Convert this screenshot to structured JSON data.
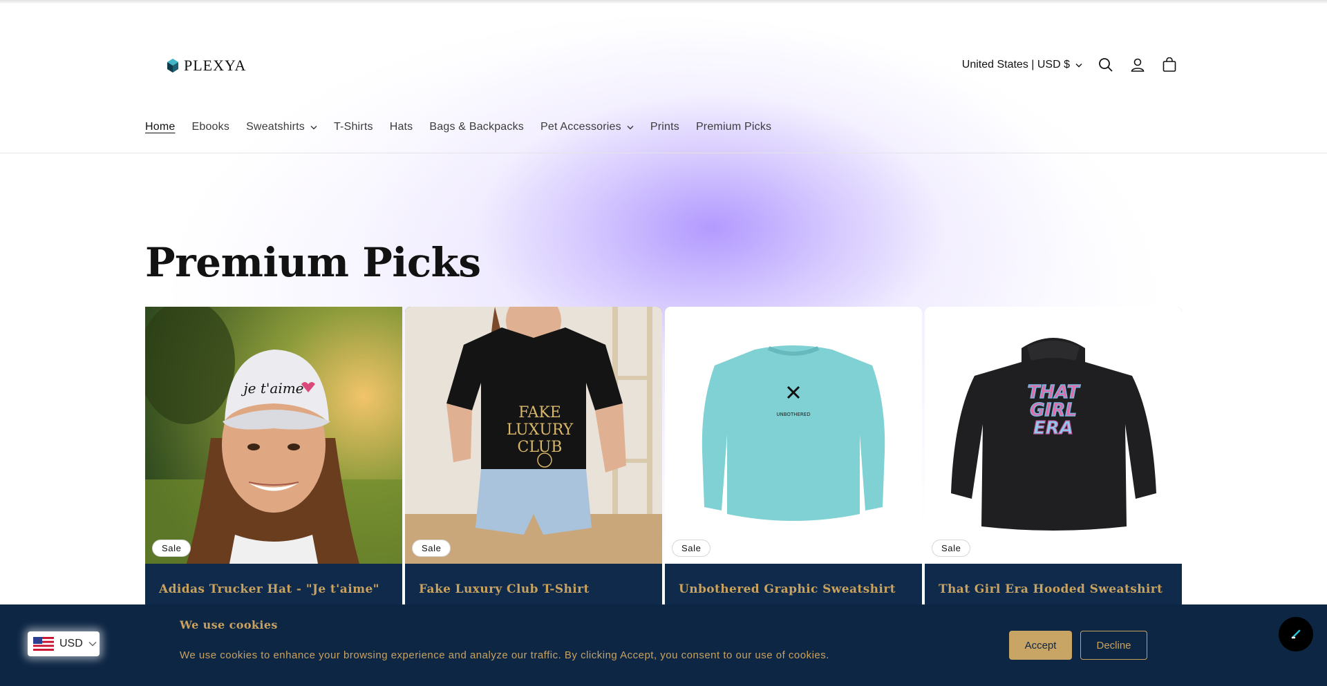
{
  "brand": {
    "name": "PLEXYA"
  },
  "header": {
    "locale": "United States | USD $"
  },
  "nav": {
    "items": [
      {
        "label": "Home",
        "active": true,
        "dropdown": false
      },
      {
        "label": "Ebooks",
        "active": false,
        "dropdown": false
      },
      {
        "label": "Sweatshirts",
        "active": false,
        "dropdown": true
      },
      {
        "label": "T-Shirts",
        "active": false,
        "dropdown": false
      },
      {
        "label": "Hats",
        "active": false,
        "dropdown": false
      },
      {
        "label": "Bags & Backpacks",
        "active": false,
        "dropdown": false
      },
      {
        "label": "Pet Accessories",
        "active": false,
        "dropdown": true
      },
      {
        "label": "Prints",
        "active": false,
        "dropdown": false
      },
      {
        "label": "Premium Picks",
        "active": false,
        "dropdown": false
      }
    ]
  },
  "section": {
    "title": "Premium Picks"
  },
  "products": [
    {
      "title": "Adidas Trucker Hat - \"Je t'aime\"",
      "badge": "Sale",
      "image_text": "je t'aime"
    },
    {
      "title": "Fake Luxury Club T-Shirt",
      "badge": "Sale",
      "image_text_lines": [
        "FAKE",
        "LUXURY",
        "CLUB"
      ]
    },
    {
      "title": "Unbothered Graphic Sweatshirt",
      "badge": "Sale",
      "image_text": "UNBOTHERED"
    },
    {
      "title": "That Girl Era Hooded Sweatshirt",
      "badge": "Sale",
      "image_text_lines": [
        "THAT",
        "GIRL",
        "ERA"
      ]
    }
  ],
  "cookie": {
    "title": "We use cookies",
    "text": "We use cookies to enhance your browsing experience and analyze our traffic. By clicking Accept, you consent to our use of cookies.",
    "accept": "Accept",
    "decline": "Decline"
  },
  "currency_selector": {
    "label": "USD"
  },
  "colors": {
    "navy": "#0d2644",
    "gold": "#c9a25f",
    "glow": "#a88cff"
  }
}
